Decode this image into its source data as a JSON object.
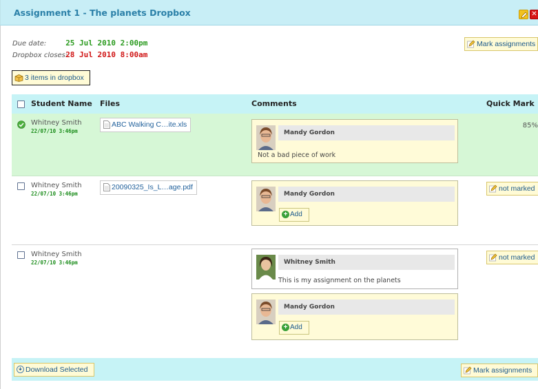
{
  "header": {
    "title": "Assignment 1 - The planets Dropbox",
    "close_glyph": "✕"
  },
  "dates": {
    "due_label": "Due date:",
    "due_value": "25 Jul 2010 2:00pm",
    "closes_label": "Dropbox closes:",
    "closes_value": "28 Jul 2010 8:00am"
  },
  "buttons": {
    "mark_assignments": "Mark assignments",
    "items_in_dropbox": "3 items in dropbox",
    "download_selected": "Download Selected",
    "add": "Add",
    "not_marked": "not marked"
  },
  "table": {
    "columns": [
      "Student Name",
      "Files",
      "Comments",
      "Quick Mark"
    ],
    "rows": [
      {
        "student": "Whitney Smith",
        "timestamp": "22/07/10 3:46pm",
        "file": "ABC Walking C…ite.xls",
        "comment_author": "Mandy Gordon",
        "comment_text": "Not a bad piece of work",
        "quick_mark": "85%"
      },
      {
        "student": "Whitney Smith",
        "timestamp": "22/07/10 3:46pm",
        "file": "20090325_Is_L…age.pdf",
        "comment_author": "Mandy Gordon",
        "quick_mark": "not marked"
      },
      {
        "student": "Whitney Smith",
        "timestamp": "22/07/10 3:46pm",
        "comment1_author": "Whitney Smith",
        "comment1_text": "This is my assignment on the planets",
        "comment2_author": "Mandy Gordon",
        "quick_mark": "not marked"
      }
    ]
  },
  "colors": {
    "header_bg": "#c8eef6",
    "title_blue": "#2b80a8",
    "due_green": "#2a9a1e",
    "closes_red": "#d01515",
    "marked_row_bg": "#d6f7d6"
  },
  "icons": [
    "edit-icon",
    "close-icon",
    "checkmark-icon",
    "checkbox-icon",
    "document-icon",
    "pencil-icon",
    "box-icon",
    "plus-icon",
    "download-icon",
    "avatar"
  ]
}
